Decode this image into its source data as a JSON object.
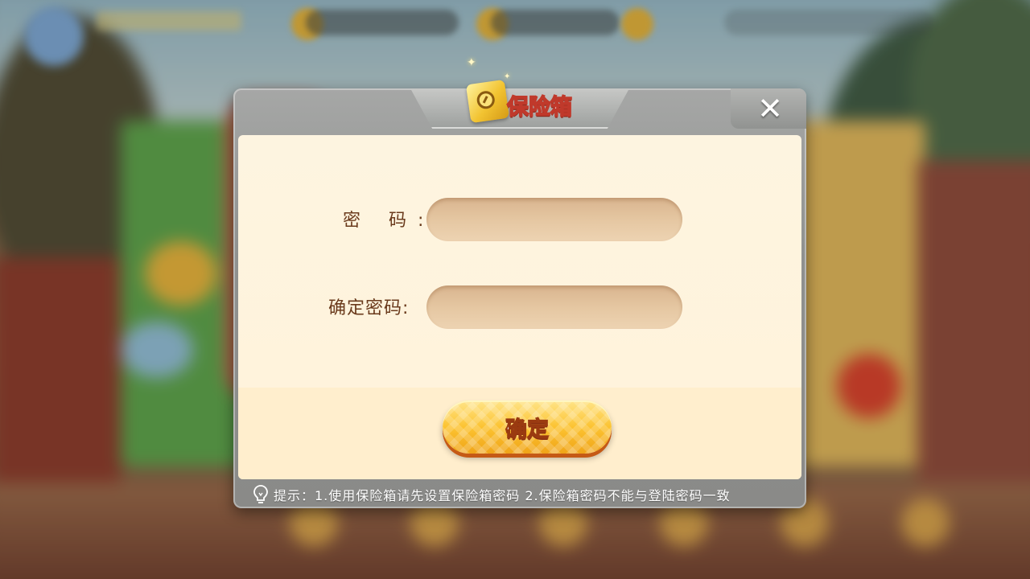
{
  "dialog": {
    "title": "保险箱",
    "close_symbol": "✕",
    "password_label": "密 码:",
    "confirm_password_label": "确定密码:",
    "password_value": "",
    "confirm_password_value": "",
    "confirm_button": "确定",
    "hint": "提示：1.使用保险箱请先设置保险箱密码 2.保险箱密码不能与登陆密码一致"
  },
  "icons": {
    "title_icon": "safe-icon",
    "close_icon": "close-icon",
    "hint_icon": "lightbulb-icon"
  },
  "colors": {
    "title_text": "#ffffff",
    "title_outline": "#c0392b",
    "button_gold": "#fcc331",
    "label_text": "#6a3a1c",
    "panel_bg": "#fdf4e0"
  }
}
